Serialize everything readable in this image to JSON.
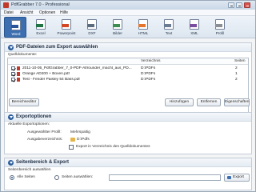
{
  "window": {
    "title": "PdfGrabber 7.0 - Professional"
  },
  "menu": [
    "Datei",
    "Ansicht",
    "Optionen",
    "Hilfe"
  ],
  "toolbar": {
    "buttons": [
      {
        "label": "Word",
        "icon": "word-icon",
        "color": "#2b579a",
        "active": true
      },
      {
        "label": "Excel",
        "icon": "excel-icon",
        "color": "#217346"
      },
      {
        "label": "Powerpoint",
        "icon": "powerpoint-icon",
        "color": "#d24726"
      },
      {
        "label": "DXF",
        "icon": "dxf-icon",
        "color": "#5a6b80"
      },
      {
        "label": "Bilder",
        "icon": "image-icon",
        "color": "#3d8f4f"
      },
      {
        "label": "HTML",
        "icon": "html-icon",
        "color": "#e3762a"
      },
      {
        "label": "Text",
        "icon": "text-icon",
        "color": "#6b7c93"
      },
      {
        "label": "XML",
        "icon": "xml-icon",
        "color": "#7a4fa0"
      },
      {
        "label": "Profil",
        "icon": "profile-icon",
        "color": "#8a8f96"
      }
    ]
  },
  "pdf_section": {
    "title": "PDF-Dateien zum Export auswählen",
    "sublabel": "Quelldokumente:",
    "columns": {
      "name": "",
      "folder": "Verzeichnis",
      "pages": "Seiten"
    },
    "rows": [
      {
        "name": "2011-10-05_PdfGrabber_7_0-PDF-Alfrounder_macht_aus_PD...",
        "folder": "D:\\PDFs",
        "pages": "2"
      },
      {
        "name": "Orange AD200 + Boxen.pdf",
        "folder": "D:\\PDFs",
        "pages": "1"
      },
      {
        "name": "Test - Fender Paisley 54 Bass.pdf",
        "folder": "D:\\PDFs",
        "pages": "2"
      }
    ],
    "buttons": {
      "editor": "Bereichseditor",
      "add": "Hinzufügen",
      "remove": "Entfernen",
      "properties": "Eigenschaften"
    }
  },
  "export_section": {
    "title": "Exportoptionen",
    "sublabel": "Aktuelle Exportoptionen:",
    "profile_label": "Ausgewählter Profil:",
    "profile_value": "Mehrspaltig",
    "dir_label": "Ausgabeverzeichnis:",
    "dir_value": "D:\\Pdfs",
    "same_dir_label": "Export in Verzeichnis des Quelldokumentes"
  },
  "range_section": {
    "title": "Seitenbereich & Export",
    "sublabel": "Seitenbereich auswählen",
    "all_pages": "Alle Seiten",
    "select_pages": "Seiten auswählen:",
    "pages_value": "",
    "export_button": "Export"
  }
}
